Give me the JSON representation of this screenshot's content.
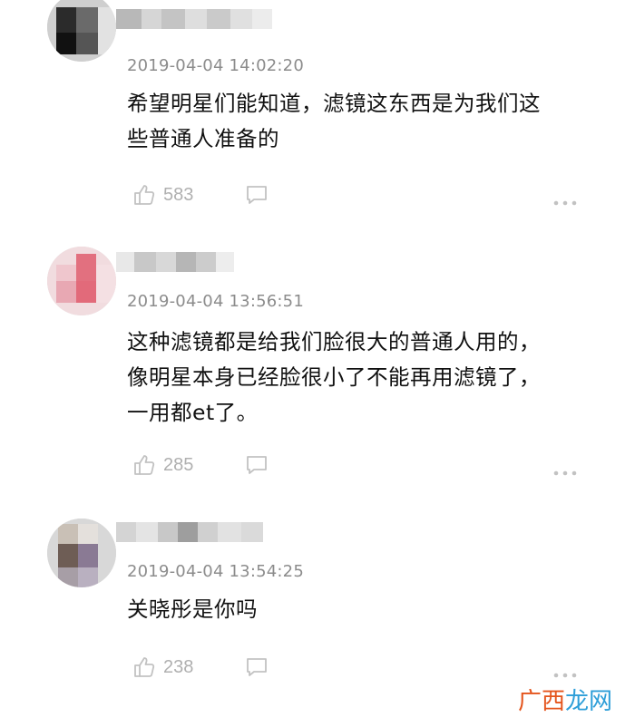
{
  "comments": [
    {
      "timestamp": "2019-04-04 14:02:20",
      "text": "希望明星们能知道，滤镜这东西是为我们这\n些普通人准备的",
      "likes": "583"
    },
    {
      "timestamp": "2019-04-04 13:56:51",
      "text": "这种滤镜都是给我们脸很大的普通人用的，\n像明星本身已经脸很小了不能再用滤镜了，\n一用都et了。",
      "likes": "285"
    },
    {
      "timestamp": "2019-04-04 13:54:25",
      "text": "关晓彤是你吗",
      "likes": "238"
    }
  ],
  "icons": {
    "like": "thumbs-up-icon",
    "reply": "comment-bubble-icon",
    "more": "more-dots-icon"
  },
  "colors": {
    "text": "#111111",
    "meta": "#8c8c8c",
    "icon": "#c2c2c2",
    "watermark_orange": "#e4541c",
    "watermark_blue": "#2d9ed8"
  },
  "watermark": {
    "part1": "广",
    "part2": "西",
    "part3": "龙网"
  }
}
